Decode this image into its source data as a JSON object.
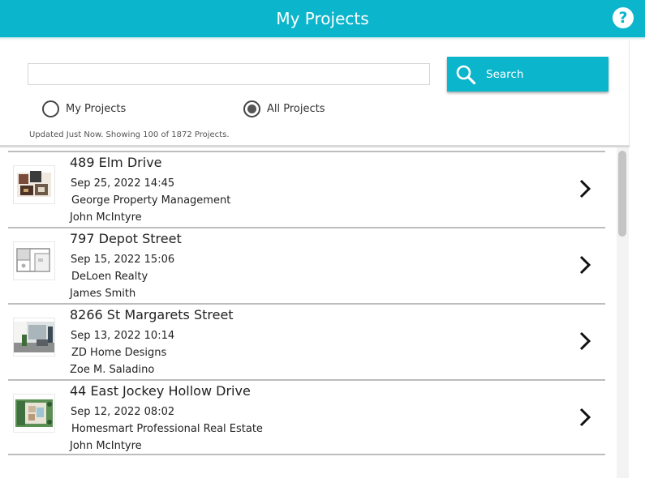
{
  "header": {
    "title": "My Projects",
    "help_icon": "question-mark-icon",
    "help_glyph": "?"
  },
  "search": {
    "input_value": "",
    "placeholder": "",
    "button_label": "Search",
    "button_icon": "search-icon"
  },
  "filters": {
    "options": [
      {
        "label": "My Projects",
        "selected": false
      },
      {
        "label": "All Projects",
        "selected": true
      }
    ]
  },
  "status": "Updated Just Now. Showing 100 of 1872 Projects.",
  "projects": [
    {
      "title": "489 Elm Drive",
      "date": "Sep 25, 2022 14:45",
      "company": "George Property Management",
      "person": "John McIntyre",
      "thumbnail": "floor-plan-3d-dark-icon"
    },
    {
      "title": "797 Depot Street",
      "date": "Sep 15, 2022 15:06",
      "company": "DeLoen Realty",
      "person": "James Smith",
      "thumbnail": "floor-plan-2d-gray-icon"
    },
    {
      "title": "8266 St Margarets Street",
      "date": "Sep 13, 2022 10:14",
      "company": "ZD Home Designs",
      "person": "Zoe M. Saladino",
      "thumbnail": "interior-room-photo-icon"
    },
    {
      "title": "44 East Jockey Hollow Drive",
      "date": "Sep 12, 2022 08:02",
      "company": "Homesmart Professional Real Estate",
      "person": "John McIntyre",
      "thumbnail": "site-plan-green-icon"
    }
  ],
  "colors": {
    "accent": "#0bb5cc",
    "divider": "#bdbdbd",
    "text": "#222222"
  }
}
